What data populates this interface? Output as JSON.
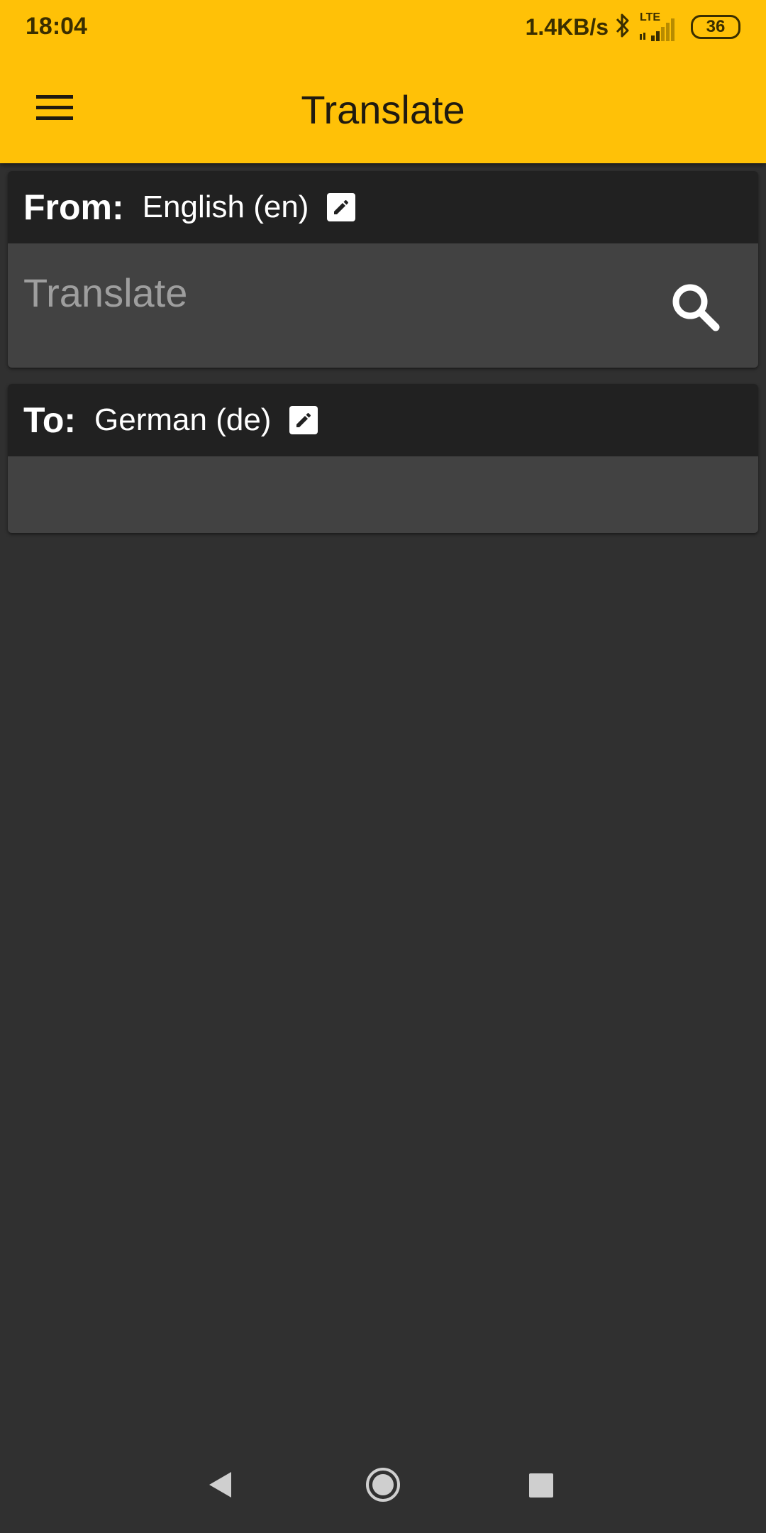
{
  "status_bar": {
    "time": "18:04",
    "net_speed": "1.4KB/s",
    "network": "LTE",
    "battery": "36",
    "icons": [
      "bluetooth-icon",
      "signal-icon",
      "battery-icon"
    ]
  },
  "app_bar": {
    "title": "Translate",
    "menu_icon": "hamburger-menu-icon",
    "color": "#FFC107"
  },
  "from_card": {
    "label": "From:",
    "language": "English (en)",
    "edit_icon": "pencil-edit-icon",
    "input_value": "",
    "input_placeholder": "Translate",
    "search_icon": "search-icon"
  },
  "to_card": {
    "label": "To:",
    "language": "German (de)",
    "edit_icon": "pencil-edit-icon",
    "output_text": ""
  },
  "nav_bar": {
    "buttons": [
      "back-icon",
      "home-icon",
      "recents-icon"
    ]
  }
}
